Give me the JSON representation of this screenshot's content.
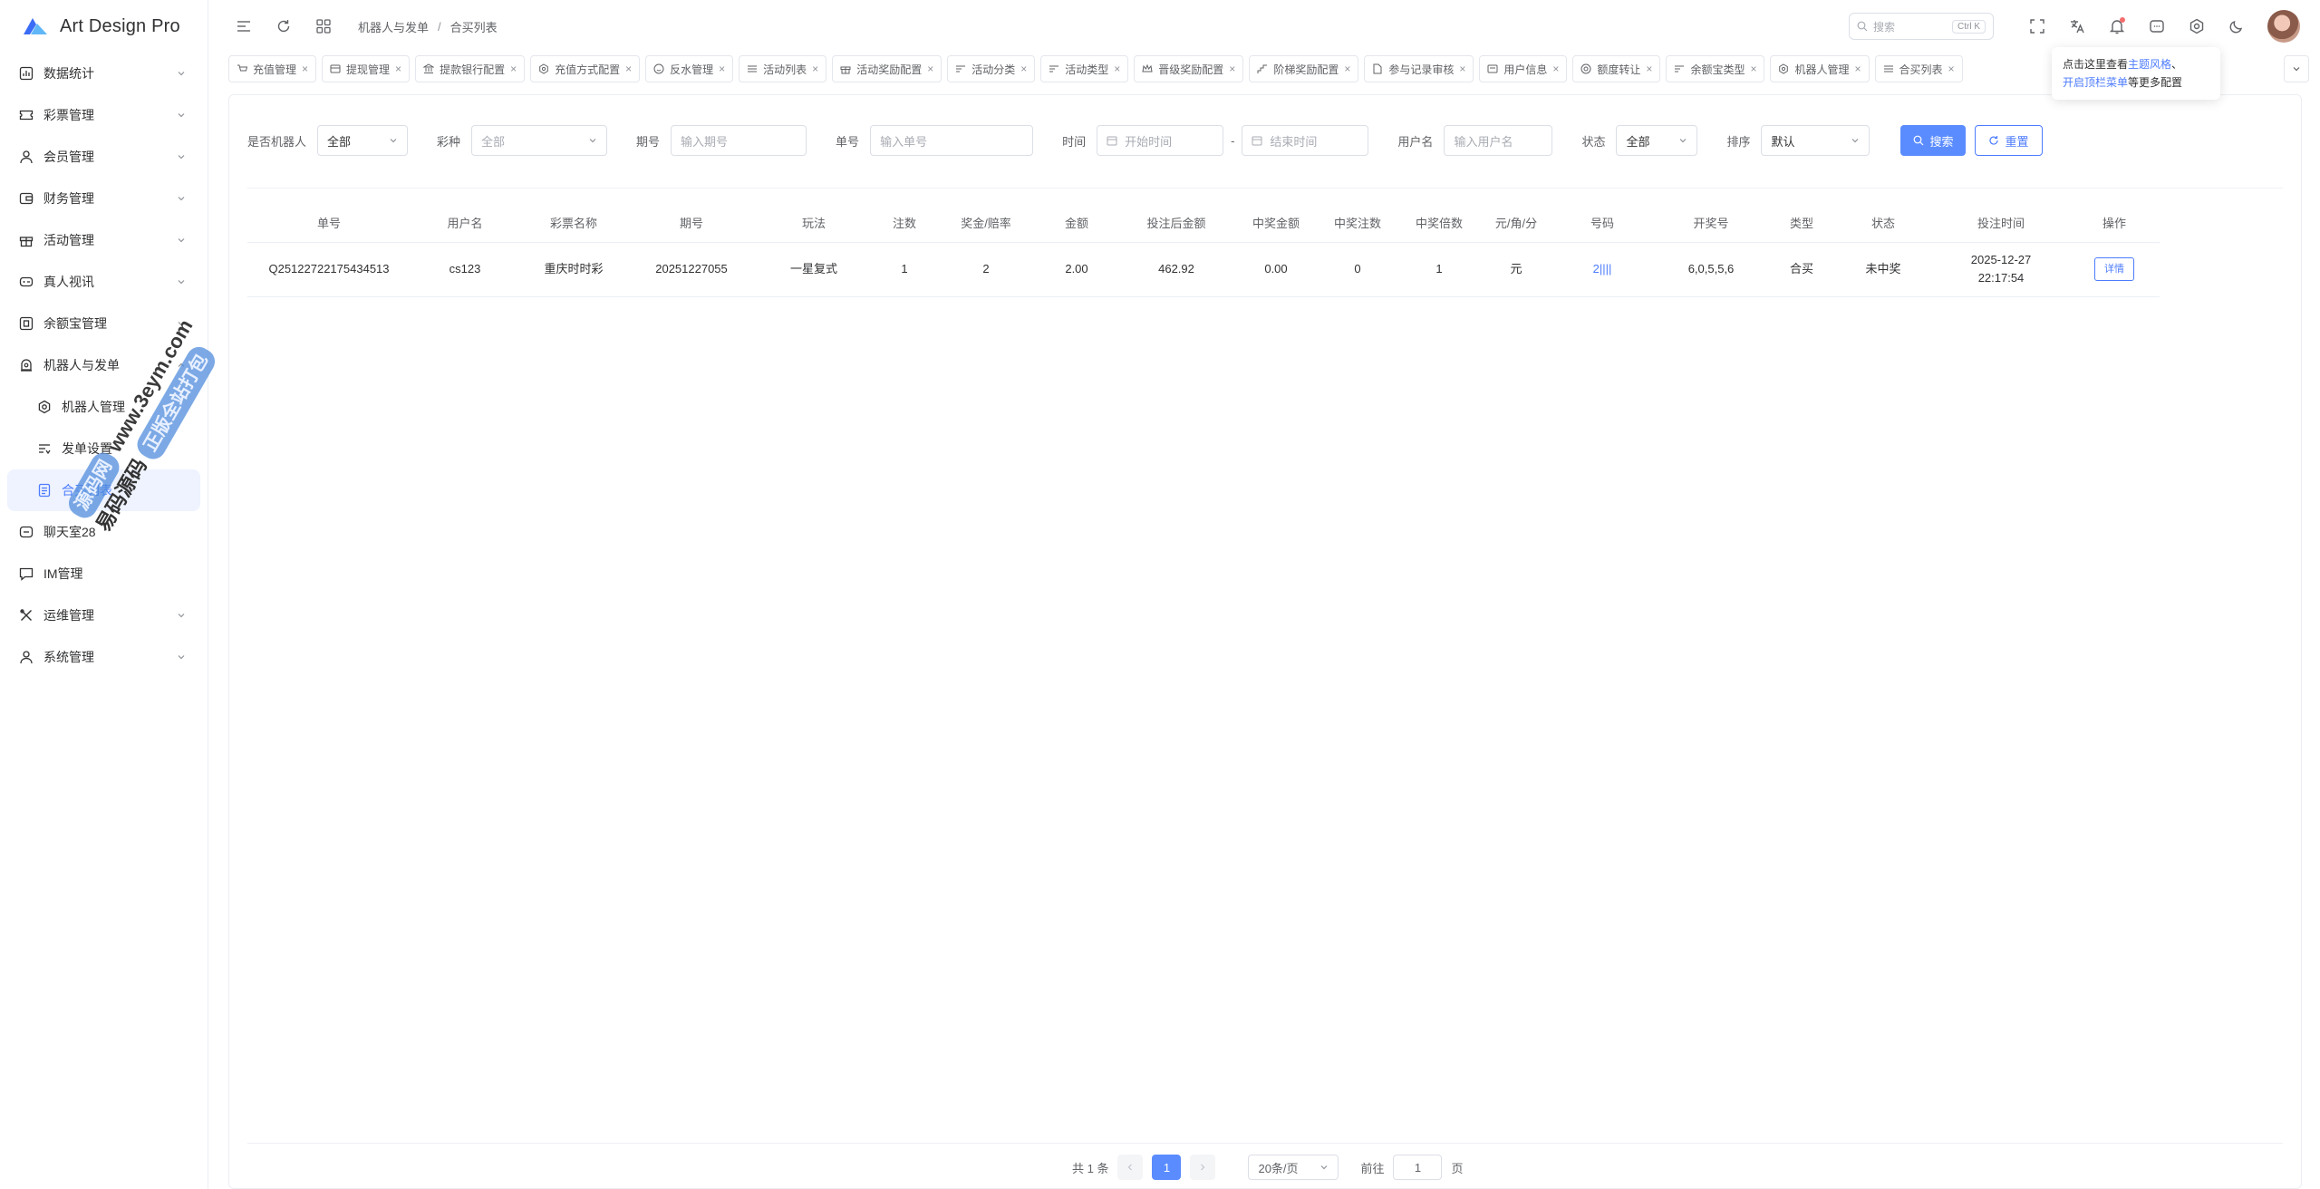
{
  "app": {
    "title": "Art Design Pro",
    "accent": "#4d7cfe",
    "primary_button": "#5a8cff"
  },
  "sidebar": {
    "items": [
      {
        "label": "数据统计",
        "icon": "bar-chart-icon"
      },
      {
        "label": "彩票管理",
        "icon": "ticket-icon"
      },
      {
        "label": "会员管理",
        "icon": "user-icon"
      },
      {
        "label": "财务管理",
        "icon": "wallet-icon"
      },
      {
        "label": "活动管理",
        "icon": "gift-icon"
      },
      {
        "label": "真人视讯",
        "icon": "video-icon"
      },
      {
        "label": "余额宝管理",
        "icon": "safe-icon"
      },
      {
        "label": "机器人与发单",
        "icon": "robot-icon"
      },
      {
        "label": "机器人管理",
        "icon": "gear-icon"
      },
      {
        "label": "发单设置",
        "icon": "filter-icon"
      },
      {
        "label": "合买列表",
        "icon": "list-icon"
      },
      {
        "label": "聊天室28",
        "icon": "chat-box-icon"
      },
      {
        "label": "IM管理",
        "icon": "message-icon"
      },
      {
        "label": "运维管理",
        "icon": "tools-icon"
      },
      {
        "label": "系统管理",
        "icon": "user-icon"
      }
    ]
  },
  "header": {
    "breadcrumb": [
      "机器人与发单",
      "合买列表"
    ],
    "search_placeholder": "搜索",
    "search_shortcut": "Ctrl K"
  },
  "tabs": [
    "充值管理",
    "提现管理",
    "提款银行配置",
    "充值方式配置",
    "反水管理",
    "活动列表",
    "活动奖励配置",
    "活动分类",
    "活动类型",
    "晋级奖励配置",
    "阶梯奖励配置",
    "参与记录审核",
    "用户信息",
    "额度转让",
    "余额宝类型",
    "机器人管理",
    "合买列表"
  ],
  "popover": {
    "line1_prefix": "点击这里查看",
    "line1_link": "主题风格",
    "line1_suffix": "、",
    "line2_link": "开启顶栏菜单",
    "line2_suffix": "等更多配置"
  },
  "filters": {
    "is_robot": {
      "label": "是否机器人",
      "value": "全部"
    },
    "lottery": {
      "label": "彩种",
      "value": "全部"
    },
    "issue": {
      "label": "期号",
      "placeholder": "输入期号"
    },
    "order_no": {
      "label": "单号",
      "placeholder": "输入单号"
    },
    "time": {
      "label": "时间",
      "start_placeholder": "开始时间",
      "separator": "-",
      "end_placeholder": "结束时间"
    },
    "username": {
      "label": "用户名",
      "placeholder": "输入用户名"
    },
    "status": {
      "label": "状态",
      "value": "全部"
    },
    "sort": {
      "label": "排序",
      "value": "默认"
    },
    "search_button": "搜索",
    "reset_button": "重置"
  },
  "table": {
    "columns": [
      "单号",
      "用户名",
      "彩票名称",
      "期号",
      "玩法",
      "注数",
      "奖金/赔率",
      "金额",
      "投注后金额",
      "中奖金额",
      "中奖注数",
      "中奖倍数",
      "元/角/分",
      "号码",
      "开奖号",
      "类型",
      "状态",
      "投注时间",
      "操作"
    ],
    "rows": [
      {
        "order_no": "Q25122722175434513",
        "username": "cs123",
        "lottery": "重庆时时彩",
        "issue": "20251227055",
        "play": "一星复式",
        "bets": "1",
        "odds": "2",
        "amount": "2.00",
        "after_amount": "462.92",
        "win_amount": "0.00",
        "win_bets": "0",
        "win_multiple": "1",
        "unit": "元",
        "numbers": "2||||",
        "draw_numbers": "6,0,5,5,6",
        "type": "合买",
        "status": "未中奖",
        "bet_date": "2025-12-27",
        "bet_time": "22:17:54",
        "action": "详情"
      }
    ]
  },
  "pagination": {
    "total": "共 1 条",
    "current_page": "1",
    "page_size": "20条/页",
    "goto_label": "前往",
    "goto_value": "1",
    "page_suffix": "页"
  },
  "watermark": {
    "site": "www.3eym.com",
    "badge1": "源码网",
    "badge2": "正版全站打包",
    "tail": "易码源码"
  }
}
